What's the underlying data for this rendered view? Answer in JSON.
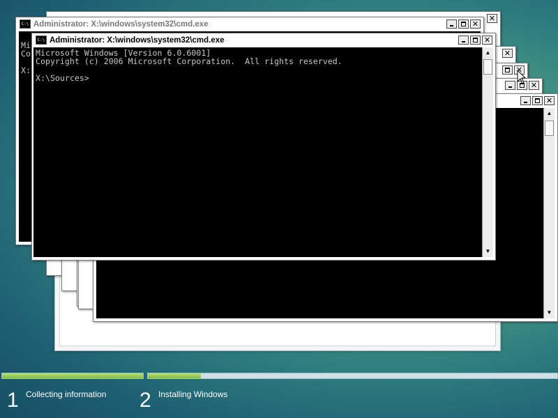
{
  "windows": [
    {
      "title": "Administrator: X:\\windows\\system32\\cmd.exe",
      "console_lines": [
        "Mi",
        "Co",
        "",
        "X:"
      ]
    },
    {
      "title": "Administrator: X:\\windows\\system32\\cmd.exe",
      "console_lines": [
        "Microsoft Windows [Version 6.0.6001]",
        "Copyright (c) 2006 Microsoft Corporation.  All rights reserved.",
        "",
        "X:\\Sources>"
      ]
    }
  ],
  "window_buttons": {
    "minimize": "_",
    "maximize": "□",
    "close": "✕"
  },
  "scroll_arrows": {
    "up": "▲",
    "down": "▼"
  },
  "progress": {
    "steps": [
      {
        "number": "1",
        "label": "Collecting information",
        "fill": 1.0
      },
      {
        "number": "2",
        "label": "Installing Windows",
        "fill": 0.13
      }
    ]
  },
  "colors": {
    "accent_green": "#7fbd3b",
    "console_bg": "#000000",
    "console_text": "#c8c8c8"
  }
}
